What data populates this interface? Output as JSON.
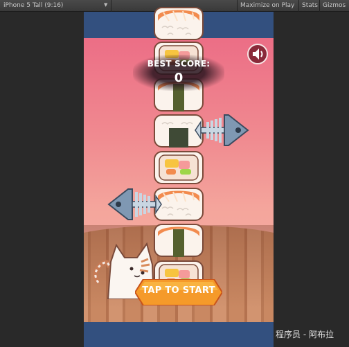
{
  "toolbar": {
    "aspect_label": "iPhone 5 Tall (9:16)",
    "maximize_label": "Maximize on Play",
    "stats_label": "Stats",
    "gizmos_label": "Gizmos"
  },
  "game": {
    "best_score_label": "BEST SCORE:",
    "best_score_value": "0",
    "start_button_label": "TAP TO START",
    "sound_icon": "speaker-icon"
  },
  "colors": {
    "sky_top": "#ec6e86",
    "sky_bottom": "#f6b6a4",
    "letterbox": "#33507f",
    "salmon": "#f28b4e",
    "rice": "#fbf3ec",
    "nori": "#3f4a36",
    "button_orange": "#f59a2a",
    "fishbone": "#7f98b3"
  },
  "watermark": "程序员 - 阿布拉"
}
